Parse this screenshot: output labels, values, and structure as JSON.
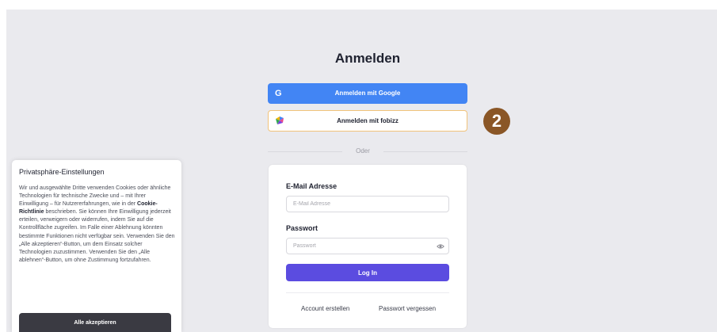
{
  "login": {
    "title": "Anmelden",
    "google_button": "Anmelden mit Google",
    "google_icon": "G",
    "fobizz_button": "Anmelden mit fobizz",
    "step_badge": "2",
    "divider_text": "Oder",
    "email_label": "E-Mail Adresse",
    "email_placeholder": "E-Mail Adresse",
    "password_label": "Passwort",
    "password_placeholder": "Passwort",
    "login_button": "Log In",
    "create_account": "Account erstellen",
    "forgot_password": "Passwort vergessen"
  },
  "cookie_banner": {
    "title": "Privatsphäre-Einstellungen",
    "text_before_link": "Wir und ausgewählte Dritte verwenden Cookies oder ähnliche Technologien für technische Zwecke und – mit Ihrer Einwilligung – für Nutzererfahrungen, wie in der ",
    "link": "Cookie-Richtlinie",
    "text_after_link": " beschrieben. Sie können Ihre Einwilligung jederzeit erteilen, verweigern oder widerrufen, indem Sie auf die Kontrollfläche zugreifen. Im Falle einer Ablehnung könnten bestimmte Funktionen nicht verfügbar sein. Verwenden Sie den „Alle akzeptieren“-Button, um dem Einsatz solcher Technologien zuzustimmen. Verwenden Sie den „Alle ablehnen“-Button, um ohne Zustimmung fortzufahren.",
    "accept_all": "Alle akzeptieren"
  },
  "colors": {
    "background": "#eaeaee",
    "google_blue": "#4285f4",
    "fobizz_border": "#f1c37a",
    "login_purple": "#5b4ce0",
    "badge_brown": "#8a5626",
    "accept_dark": "#3a3a42"
  },
  "icons": {
    "google": "google-icon",
    "fobizz": "fobizz-icon",
    "eye": "eye-icon"
  }
}
